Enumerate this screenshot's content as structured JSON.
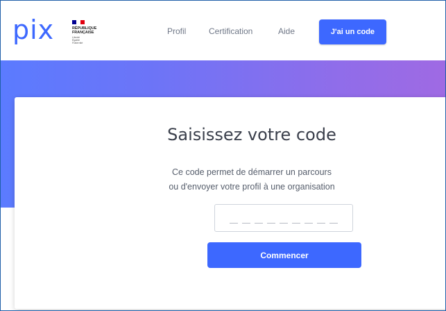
{
  "header": {
    "logo_text": "pix",
    "gov_block": {
      "flag_colors": [
        "#000091",
        "#ffffff",
        "#e1000f"
      ],
      "title": "RÉPUBLIQUE\nFRANÇAISE",
      "motto": "Liberté\nÉgalité\nFraternité"
    },
    "nav": [
      "Profil",
      "Certification",
      "Aide"
    ],
    "cta_label": "J'ai un code"
  },
  "main": {
    "title": "Saisissez votre code",
    "description_line1": "Ce code permet de démarrer un parcours",
    "description_line2": "ou d'envoyer votre profil à une organisation",
    "code_slots": 9,
    "submit_label": "Commencer"
  },
  "colors": {
    "brand_blue": "#3d68ff",
    "banner_start": "#5b7bff",
    "banner_end": "#9f6ae3"
  }
}
